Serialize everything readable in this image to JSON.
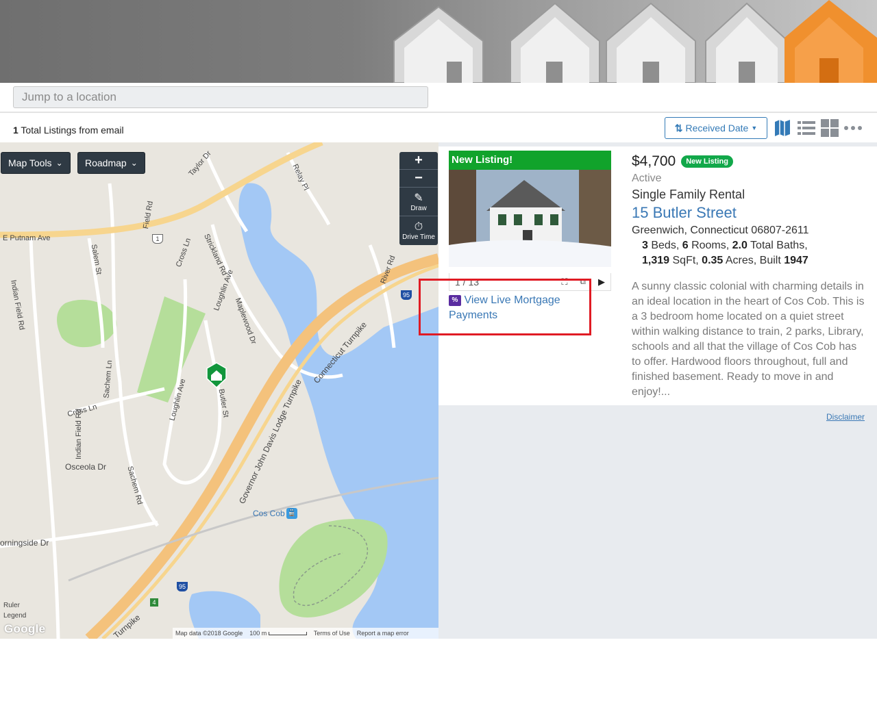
{
  "search": {
    "placeholder": "Jump to a location"
  },
  "listings_bar": {
    "count": "1",
    "count_suffix": " Total Listings from email",
    "sort_label": "Received Date",
    "view_icons": [
      "map-view-icon",
      "list-view-icon",
      "grid-view-icon",
      "more-icon"
    ]
  },
  "map": {
    "tools_label": "Map Tools",
    "type_label": "Roadmap",
    "zoom_in": "+",
    "zoom_out": "−",
    "draw_label": "Draw",
    "drive_time_label": "Drive Time",
    "footer": {
      "data": "Map data ©2018 Google",
      "scale": "100 m",
      "terms": "Terms of Use",
      "report": "Report a map error"
    },
    "logo": "Google",
    "ruler": "Ruler",
    "legend": "Legend",
    "labels": {
      "e_putnam": "E Putnam Ave",
      "indian_field": "Indian Field Rd",
      "indian_field2": "Indian Field Rd",
      "salem": "Salem St",
      "field": "Field Rd",
      "cross_ln": "Cross Ln",
      "cross_ln2": "Cross Ln",
      "strickland": "Strickland Rd",
      "loughlin": "Loughlin Ave",
      "loughlin2": "Loughlin Ave",
      "maplewood": "Maplewood Dr",
      "butler": "Butler St",
      "sachem": "Sachem Ln",
      "sachem_rd": "Sachem Rd",
      "osceola": "Osceola Dr",
      "morningside": "orningside Dr",
      "turnpike": "Governor John Davis Lodge Turnpike",
      "ct_turnpike": "Connecticut Turnpike",
      "turnpike_bottom": "Turnpike",
      "river": "River Rd",
      "cos_cob": "Cos Cob",
      "taylor": "Taylor Dr",
      "relay": "Relay Pl",
      "route1": "1",
      "i95": "95",
      "i95b": "95",
      "route4": "4"
    }
  },
  "listing": {
    "banner": "New Listing!",
    "photo_counter": "1 / 13",
    "mortgage_link": "View Live Mortgage Payments",
    "price": "$4,700",
    "badge": "New Listing",
    "status": "Active",
    "type": "Single Family Rental",
    "address": "15 Butler Street",
    "city": "Greenwich, Connecticut 06807-2611",
    "beds": "3",
    "beds_label": " Beds, ",
    "rooms": "6",
    "rooms_label": " Rooms,  ",
    "baths": "2.0",
    "baths_label": "  Total Baths,",
    "sqft": "1,319",
    "sqft_label": " SqFt, ",
    "acres": "0.35",
    "acres_label": " Acres,  Built ",
    "built": "1947",
    "description": "A sunny classic colonial with charming details in an ideal location in the heart of Cos Cob. This is a 3 bedroom home located on a quiet street within walking distance to train, 2 parks, Library, schools and all that the village of Cos Cob has to offer. Hardwood floors throughout, full and finished basement. Ready to move in and enjoy!..."
  },
  "disclaimer": "Disclaimer",
  "colors": {
    "accent": "#337ab7",
    "new_green": "#11a32b",
    "highlight_red": "#e01b24",
    "water": "#a3c8f5",
    "park": "#b5de9a"
  }
}
